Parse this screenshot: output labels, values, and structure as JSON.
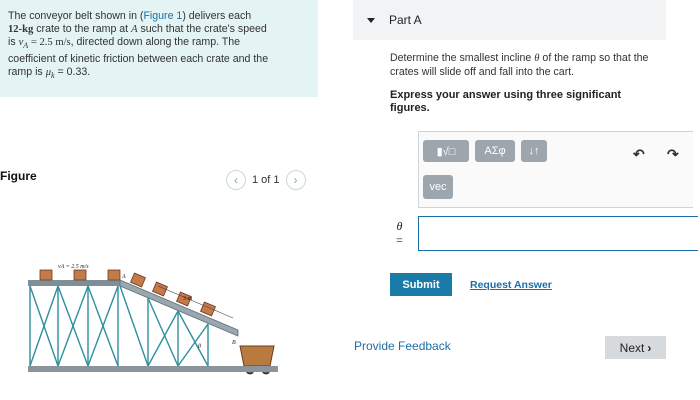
{
  "problem": {
    "p1": "The conveyor belt shown in (",
    "figure_link": "Figure 1",
    "p2": ") delivers each",
    "mass": "12-kg",
    "p3": " crate to the ramp at ",
    "point_a": "A",
    "p4": " such that the crate's speed",
    "p5": "is ",
    "v_symbol": "v",
    "v_sub": "A",
    "v_value": " = 2.5 m/s",
    "p6": ", directed down along the ramp. The",
    "p7": "coefficient of kinetic friction between each crate and the",
    "p8": "ramp is ",
    "mu_symbol": "μ",
    "mu_sub": "k",
    "mu_value": " = 0.33."
  },
  "figure": {
    "label": "Figure",
    "pager_text": "1 of 1",
    "prev_icon": "chevron-left",
    "next_icon": "chevron-right",
    "annotation_velocity": "vA = 2.5 m/s",
    "annotation_length": "3 m",
    "annotation_theta": "θ",
    "annotation_a": "A",
    "annotation_b": "B"
  },
  "part": {
    "title": "Part A",
    "question_prefix": "Determine the smallest incline ",
    "question_theta": "θ",
    "question_suffix": " of the ramp so that the crates will slide off and fall into the cart.",
    "instruction": "Express your answer using three significant figures.",
    "toolbar": {
      "template_label": "▮√□",
      "greek_label": "ΑΣφ",
      "updown_label": "↓↑",
      "vec_label": "vec",
      "undo_icon": "undo-arrow",
      "redo_icon": "redo-arrow"
    },
    "answer_label_symbol": "θ",
    "answer_label_eq": "=",
    "answer_value": "",
    "submit_label": "Submit",
    "request_label": "Request Answer"
  },
  "footer": {
    "feedback_label": "Provide Feedback",
    "next_label": "Next",
    "next_icon": "chevron-right"
  },
  "colors": {
    "problem_bg": "#e4f3f3",
    "link": "#1a6fa8",
    "submit_bg": "#1a7aa8",
    "toolbar_btn": "#9ea6ad",
    "next_bg": "#d7dadd",
    "ramp": "#7f8f98",
    "truss": "#2f8f9f",
    "crate": "#c47a4a"
  }
}
